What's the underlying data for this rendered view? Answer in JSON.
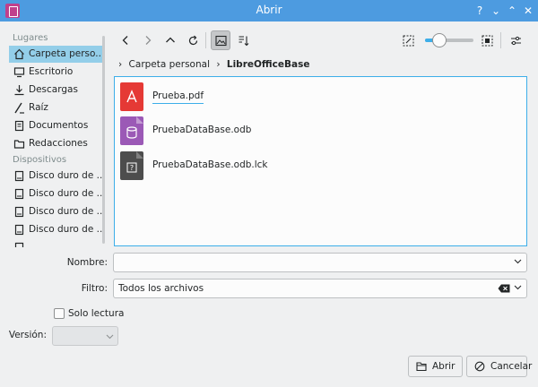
{
  "window": {
    "title": "Abrir",
    "controls": [
      "?",
      "⌄",
      "⌃",
      "✕"
    ]
  },
  "sidebar": {
    "places_header": "Lugares",
    "places": [
      {
        "label": "Carpeta perso...",
        "icon": "home-icon"
      },
      {
        "label": "Escritorio",
        "icon": "desktop-icon"
      },
      {
        "label": "Descargas",
        "icon": "download-icon"
      },
      {
        "label": "Raíz",
        "icon": "root-icon"
      },
      {
        "label": "Documentos",
        "icon": "documents-icon"
      },
      {
        "label": "Redacciones",
        "icon": "folder-icon"
      }
    ],
    "devices_header": "Dispositivos",
    "devices": [
      {
        "label": "Disco duro de ...",
        "icon": "hard-drive-icon"
      },
      {
        "label": "Disco duro de ...",
        "icon": "hard-drive-icon"
      },
      {
        "label": "Disco duro de ...",
        "icon": "hard-drive-icon"
      },
      {
        "label": "Disco duro de ...",
        "icon": "hard-drive-icon"
      },
      {
        "label": "...",
        "icon": "hard-drive-icon"
      }
    ]
  },
  "breadcrumb": {
    "items": [
      "Carpeta personal",
      "LibreOfficeBase"
    ]
  },
  "files": [
    {
      "name": "Prueba.pdf",
      "icon": "pdf-file-icon",
      "color": "#e53935"
    },
    {
      "name": "PruebaDataBase.odb",
      "icon": "database-file-icon",
      "color": "#9b59b6"
    },
    {
      "name": "PruebaDataBase.odb.lck",
      "icon": "lock-file-icon",
      "color": "#4d4d4d"
    }
  ],
  "zoom": {
    "level": 0.3
  },
  "form": {
    "name_label": "Nombre:",
    "name_value": "",
    "filter_label": "Filtro:",
    "filter_value": "Todos los archivos",
    "readonly_label": "Solo lectura",
    "version_label": "Versión:"
  },
  "buttons": {
    "open": "Abrir",
    "cancel": "Cancelar"
  },
  "colors": {
    "titlebar": "#4d9be0",
    "accent": "#3daee9",
    "selection": "#93cee9"
  }
}
